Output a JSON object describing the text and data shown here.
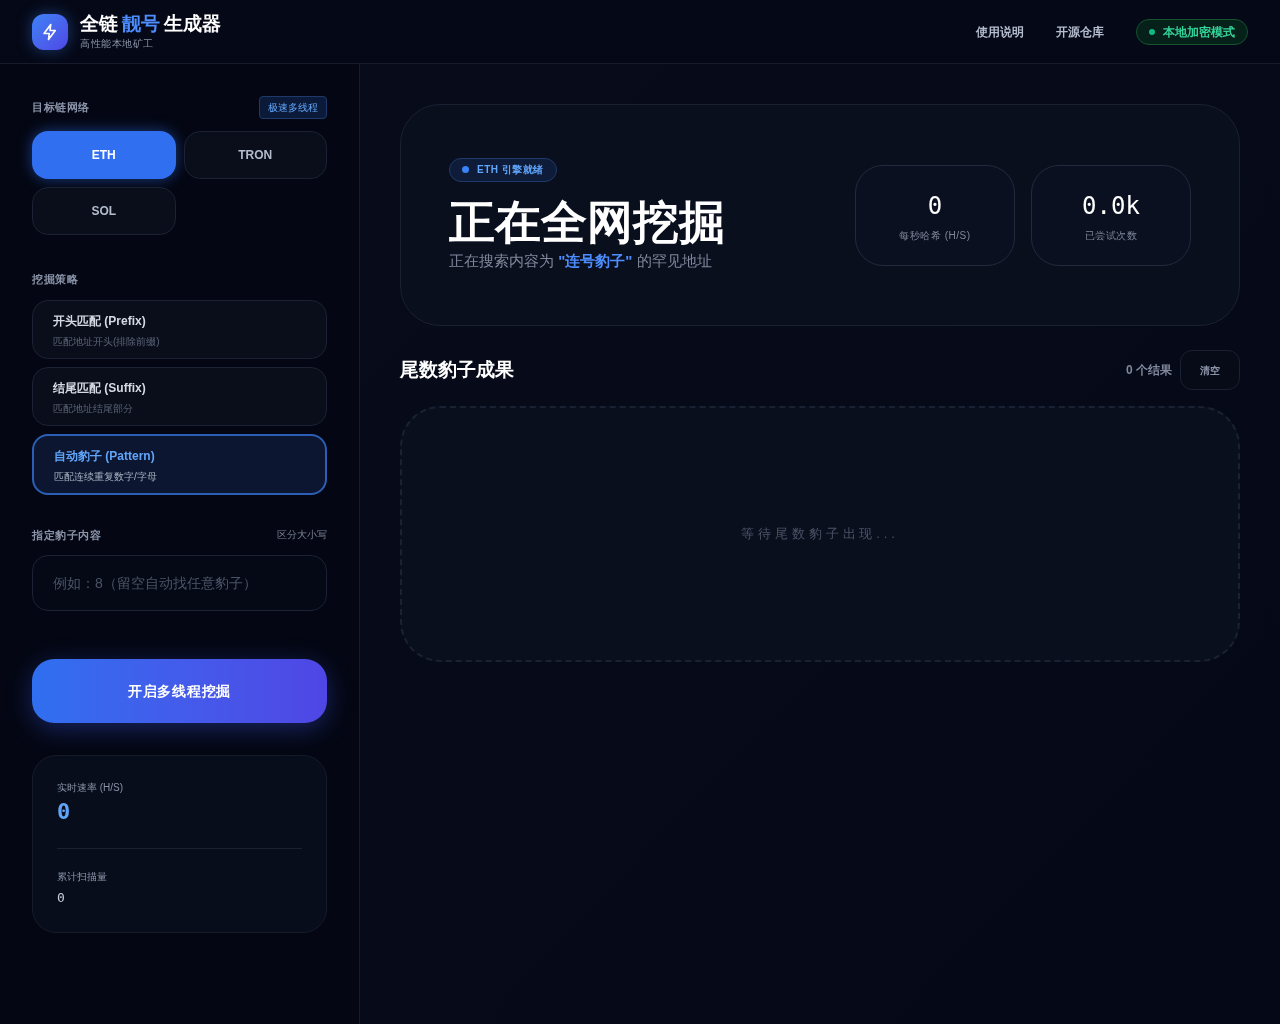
{
  "header": {
    "title_parts": [
      {
        "text": "全链",
        "accent": false
      },
      {
        "text": "靓号",
        "accent": true
      },
      {
        "text": "生成器",
        "accent": false
      }
    ],
    "subtitle": "高性能本地矿工",
    "nav": [
      "使用说明",
      "开源仓库"
    ],
    "status_badge": "本地加密模式"
  },
  "sidebar": {
    "network_label": "目标链网络",
    "network_badge": "极速多线程",
    "networks": [
      {
        "label": "ETH",
        "selected": true
      },
      {
        "label": "TRON",
        "selected": false
      },
      {
        "label": "SOL",
        "selected": false
      }
    ],
    "strategy_label": "挖掘策略",
    "strategies": [
      {
        "title": "开头匹配 (Prefix)",
        "description": "匹配地址开头(排除前缀)",
        "selected": false
      },
      {
        "title": "结尾匹配 (Suffix)",
        "description": "匹配地址结尾部分",
        "selected": false
      },
      {
        "title": "自动豹子 (Pattern)",
        "description": "匹配连续重复数字/字母",
        "selected": true
      }
    ],
    "content_label": "指定豹子内容",
    "content_hint": "区分大小写",
    "content_placeholder": "例如：8（留空自动找任意豹子）",
    "start_button": "开启多线程挖掘",
    "stats": [
      {
        "label": "实时速率 (H/S)",
        "value": "0",
        "kind": "accent"
      },
      {
        "label": "累计扫描量",
        "value": "0",
        "kind": "plain"
      }
    ]
  },
  "hero": {
    "badge": "ETH 引擎就绪",
    "title": "正在全网挖掘",
    "search_parts": [
      {
        "text": "正在搜索内容为 ",
        "accent": false
      },
      {
        "text": "\"连号豹子\"",
        "accent": true
      },
      {
        "text": " 的罕见地址",
        "accent": false
      }
    ],
    "metrics": [
      {
        "value": "0",
        "label": "每秒哈希 (H/S)"
      },
      {
        "value": "0.0k",
        "label": "已尝试次数"
      }
    ]
  },
  "results": {
    "title": "尾数豹子成果",
    "count": "0 个结果",
    "clear_button": "清空",
    "empty_text": "等待尾数豹子出现..."
  }
}
